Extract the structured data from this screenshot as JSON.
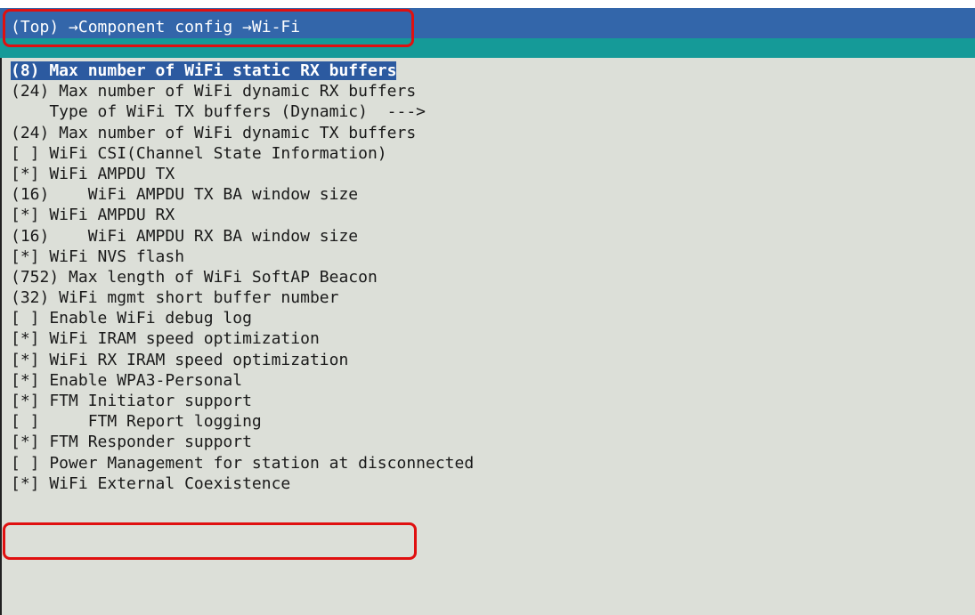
{
  "breadcrumb": "(Top) →Component config →Wi-Fi",
  "colors": {
    "path_bar": "#3366aa",
    "teal_bar": "#159a98",
    "menu_background": "#dcdfd8",
    "selection": "#2c5aa0",
    "annotation": "#e01010"
  },
  "menu": {
    "items": [
      "(8) Max number of WiFi static RX buffers",
      "(24) Max number of WiFi dynamic RX buffers",
      "    Type of WiFi TX buffers (Dynamic)  --->",
      "(24) Max number of WiFi dynamic TX buffers",
      "[ ] WiFi CSI(Channel State Information)",
      "[*] WiFi AMPDU TX",
      "(16)    WiFi AMPDU TX BA window size",
      "[*] WiFi AMPDU RX",
      "(16)    WiFi AMPDU RX BA window size",
      "[*] WiFi NVS flash",
      "(752) Max length of WiFi SoftAP Beacon",
      "(32) WiFi mgmt short buffer number",
      "[ ] Enable WiFi debug log",
      "[*] WiFi IRAM speed optimization",
      "[*] WiFi RX IRAM speed optimization",
      "[*] Enable WPA3-Personal",
      "[*] FTM Initiator support",
      "[ ]     FTM Report logging",
      "[*] FTM Responder support",
      "[ ] Power Management for station at disconnected",
      "[*] WiFi External Coexistence"
    ]
  }
}
